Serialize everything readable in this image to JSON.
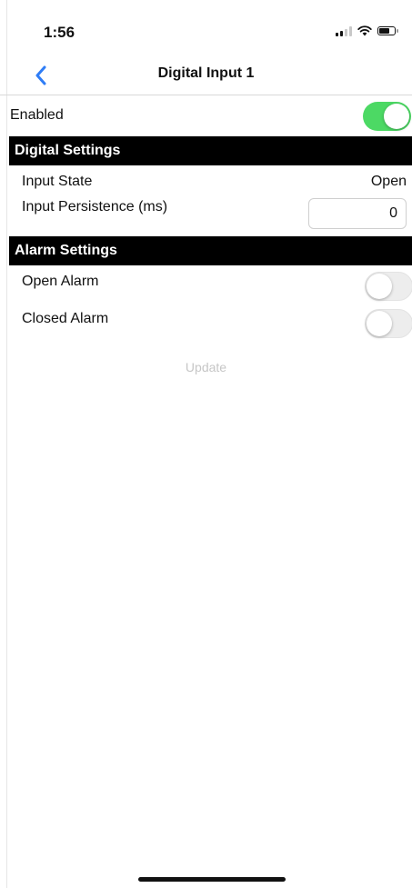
{
  "status_bar": {
    "time": "1:56",
    "icons": [
      "cellular-signal-icon",
      "wifi-icon",
      "battery-icon"
    ]
  },
  "nav": {
    "back_icon": "chevron-left-icon",
    "title": "Digital Input 1"
  },
  "enabled": {
    "label": "Enabled",
    "toggle_on": true
  },
  "digital_settings": {
    "header": "Digital Settings",
    "input_state_label": "Input State",
    "input_state_value": "Open",
    "input_persistence_label": "Input Persistence (ms)",
    "input_persistence_value": "0"
  },
  "alarm_settings": {
    "header": "Alarm Settings",
    "open_alarm_label": "Open Alarm",
    "open_alarm_on": false,
    "closed_alarm_label": "Closed Alarm",
    "closed_alarm_on": false
  },
  "update_label": "Update",
  "colors": {
    "accent": "#2f7df6",
    "toggle_on": "#4cd964",
    "section_header_bg": "#000000",
    "disabled_text": "#c6c6c6"
  }
}
